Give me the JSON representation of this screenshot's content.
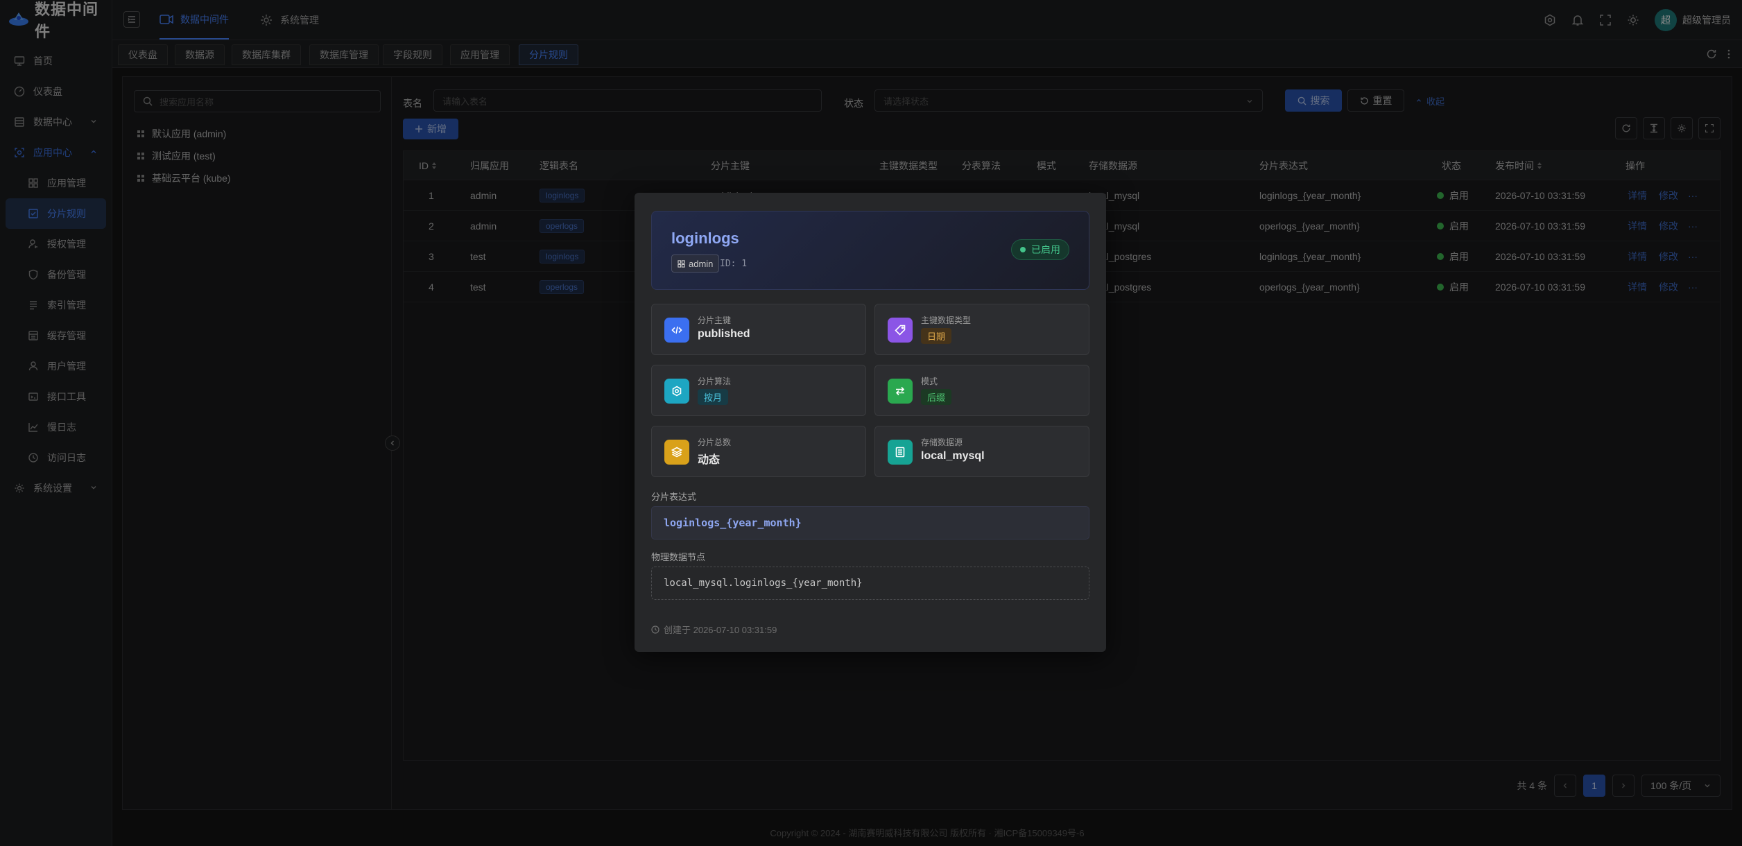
{
  "app": {
    "name": "数据中间件"
  },
  "sidebar": {
    "items": [
      {
        "label": "首页",
        "icon": "monitor-icon"
      },
      {
        "label": "仪表盘",
        "icon": "dashboard-icon"
      },
      {
        "label": "数据中心",
        "icon": "database-icon"
      },
      {
        "label": "应用中心",
        "icon": "app-center-icon"
      },
      {
        "label": "应用管理",
        "icon": "grid-icon"
      },
      {
        "label": "分片规则",
        "icon": "shard-rule-icon"
      },
      {
        "label": "授权管理",
        "icon": "user-key-icon"
      },
      {
        "label": "备份管理",
        "icon": "shield-icon"
      },
      {
        "label": "索引管理",
        "icon": "index-icon"
      },
      {
        "label": "缓存管理",
        "icon": "cache-icon"
      },
      {
        "label": "用户管理",
        "icon": "user-icon"
      },
      {
        "label": "接口工具",
        "icon": "api-icon"
      },
      {
        "label": "慢日志",
        "icon": "chart-line-icon"
      },
      {
        "label": "访问日志",
        "icon": "history-icon"
      },
      {
        "label": "系统设置",
        "icon": "gear-icon"
      }
    ]
  },
  "header": {
    "menus": [
      {
        "label": "数据中间件"
      },
      {
        "label": "系统管理"
      }
    ],
    "user": {
      "avatar_text": "超",
      "name": "超级管理员"
    }
  },
  "tabs": [
    {
      "label": "仪表盘"
    },
    {
      "label": "数据源"
    },
    {
      "label": "数据库集群"
    },
    {
      "label": "数据库管理"
    },
    {
      "label": "字段规则"
    },
    {
      "label": "应用管理"
    },
    {
      "label": "分片规则"
    }
  ],
  "tree": {
    "search_placeholder": "搜索应用名称",
    "nodes": [
      {
        "label": "默认应用 (admin)"
      },
      {
        "label": "测试应用 (test)"
      },
      {
        "label": "基础云平台 (kube)"
      }
    ]
  },
  "filters": {
    "table_label": "表名",
    "table_placeholder": "请输入表名",
    "status_label": "状态",
    "status_placeholder": "请选择状态",
    "search_btn": "搜索",
    "reset_btn": "重置",
    "collapse_btn": "收起",
    "add_btn": "新增"
  },
  "table": {
    "columns": [
      "ID",
      "归属应用",
      "逻辑表名",
      "分片主键",
      "主键数据类型",
      "分表算法",
      "模式",
      "存储数据源",
      "分片表达式",
      "状态",
      "发布时间",
      "操作"
    ],
    "rows": [
      {
        "id": "1",
        "app": "admin",
        "table": "loginlogs",
        "key": "published",
        "ds": "local_mysql",
        "expr": "loginlogs_{year_month}",
        "status": "启用",
        "time": "2026-07-10 03:31:59"
      },
      {
        "id": "2",
        "app": "admin",
        "table": "operlogs",
        "key": "",
        "ds": "local_mysql",
        "expr": "operlogs_{year_month}",
        "status": "启用",
        "time": "2026-07-10 03:31:59"
      },
      {
        "id": "3",
        "app": "test",
        "table": "loginlogs",
        "key": "",
        "ds": "local_postgres",
        "expr": "loginlogs_{year_month}",
        "status": "启用",
        "time": "2026-07-10 03:31:59"
      },
      {
        "id": "4",
        "app": "test",
        "table": "operlogs",
        "key": "",
        "ds": "local_postgres",
        "expr": "operlogs_{year_month}",
        "status": "启用",
        "time": "2026-07-10 03:31:59"
      }
    ],
    "actions": {
      "detail": "详情",
      "edit": "修改",
      "more": "···"
    }
  },
  "pager": {
    "total": "共 4 条",
    "current": "1",
    "page_size": "100 条/页"
  },
  "footer": {
    "copyright": "Copyright © 2024 - 湖南赛明威科技有限公司 版权所有 · 湘ICP备15009349号-6"
  },
  "modal": {
    "title": "loginlogs",
    "app": "admin",
    "id_text": "ID: 1",
    "status": "已启用",
    "cards": [
      {
        "label": "分片主键",
        "value": "published",
        "icon": "code-icon",
        "color": "#3b6ff0"
      },
      {
        "label": "主键数据类型",
        "value": "日期",
        "icon": "tag-icon",
        "color": "#8b55e6"
      },
      {
        "label": "分片算法",
        "value": "按月",
        "icon": "cog-icon",
        "color": "#1da6c2"
      },
      {
        "label": "模式",
        "value": "后缀",
        "icon": "swap-icon",
        "color": "#2aa84f"
      },
      {
        "label": "分片总数",
        "value": "动态",
        "icon": "layers-icon",
        "color": "#d9a11a"
      },
      {
        "label": "存储数据源",
        "value": "local_mysql",
        "icon": "db-list-icon",
        "color": "#16a394"
      }
    ],
    "expr_label": "分片表达式",
    "expr_value": "loginlogs_{year_month}",
    "node_label": "物理数据节点",
    "node_value": "local_mysql.loginlogs_{year_month}",
    "created": "创建于 2026-07-10 03:31:59"
  }
}
